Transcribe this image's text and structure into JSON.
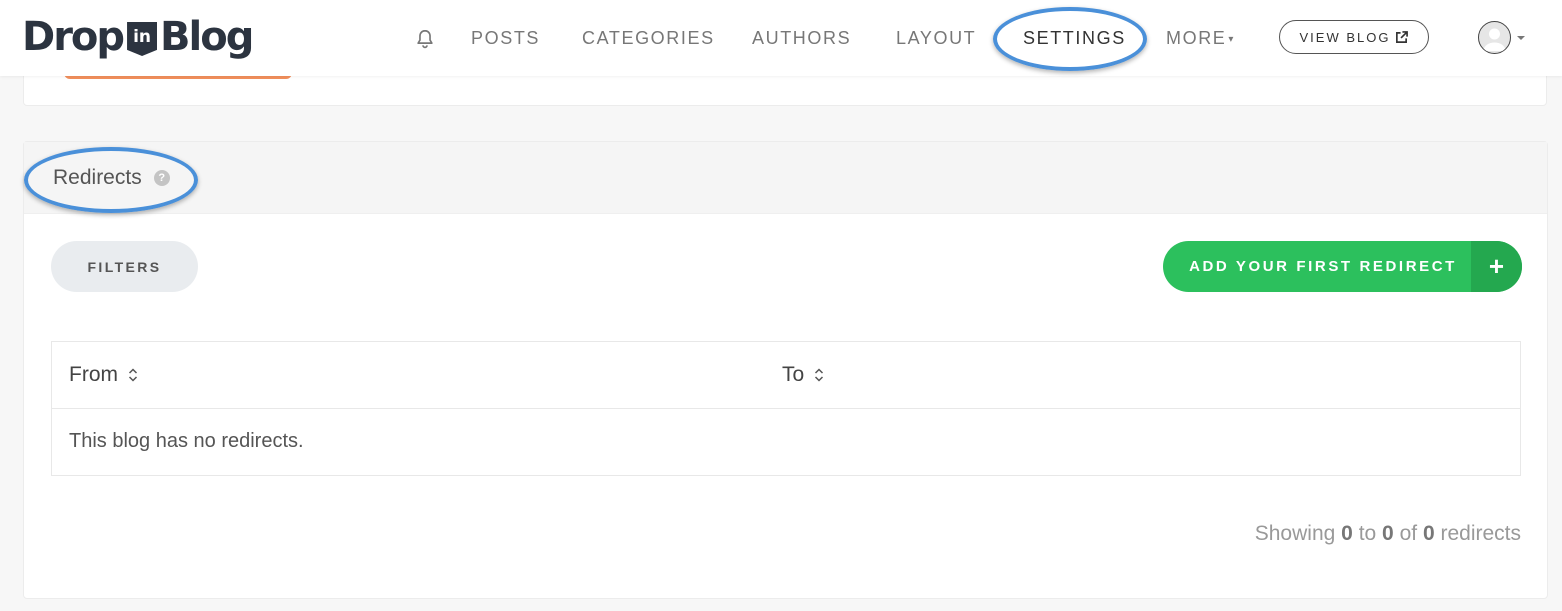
{
  "brand": {
    "logo_left": "Drop",
    "logo_badge": "in",
    "logo_right": "Blog"
  },
  "nav": {
    "bell_icon": "bell-icon",
    "items": [
      {
        "label": "POSTS"
      },
      {
        "label": "CATEGORIES"
      },
      {
        "label": "AUTHORS"
      },
      {
        "label": "LAYOUT"
      },
      {
        "label": "SETTINGS",
        "active": true
      },
      {
        "label": "MORE"
      }
    ],
    "view_blog_label": "VIEW BLOG",
    "view_blog_icon": "external-link-icon",
    "avatar_icon": "user-avatar-icon"
  },
  "redirects": {
    "title": "Redirects",
    "help_glyph": "?",
    "filters_label": "FILTERS",
    "add_label": "ADD YOUR FIRST REDIRECT",
    "add_icon": "plus-icon",
    "add_glyph": "+",
    "columns": [
      {
        "label": "From"
      },
      {
        "label": "To"
      }
    ],
    "empty_message": "This blog has no redirects.",
    "showing": {
      "prefix": "Showing",
      "from": "0",
      "to_word": "to",
      "to": "0",
      "of_word": "of",
      "total": "0",
      "suffix": "redirects"
    }
  },
  "colors": {
    "accent_green": "#2cc05d",
    "accent_green_dark": "#24a84f",
    "highlight_blue": "#4a90d9",
    "orange": "#f07b3f"
  }
}
